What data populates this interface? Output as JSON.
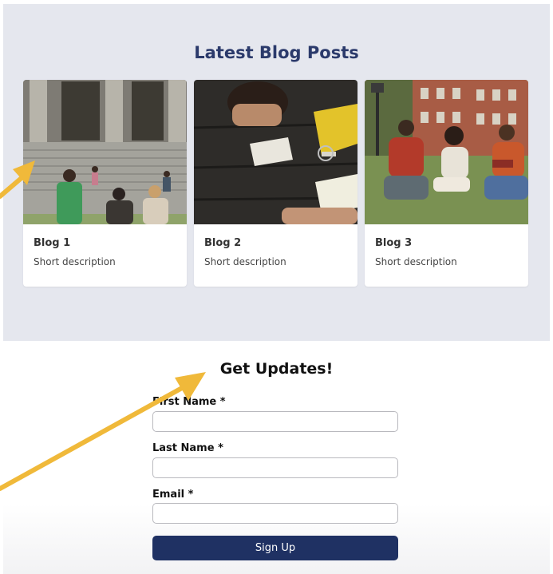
{
  "blog": {
    "heading": "Latest Blog Posts",
    "posts": [
      {
        "title": "Blog 1",
        "description": "Short description",
        "image": "campus-steps-photo"
      },
      {
        "title": "Blog 2",
        "description": "Short description",
        "image": "students-studying-table-photo"
      },
      {
        "title": "Blog 3",
        "description": "Short description",
        "image": "students-on-lawn-photo"
      }
    ]
  },
  "signup": {
    "title": "Get Updates!",
    "first_name_label": "First Name *",
    "last_name_label": "Last Name *",
    "email_label": "Email *",
    "first_name_value": "",
    "last_name_value": "",
    "email_value": "",
    "button_label": "Sign Up"
  },
  "colors": {
    "heading": "#2b3a6b",
    "button": "#1f3163",
    "section_bg": "#e5e7ee",
    "annotation_arrow": "#f0b93a"
  }
}
